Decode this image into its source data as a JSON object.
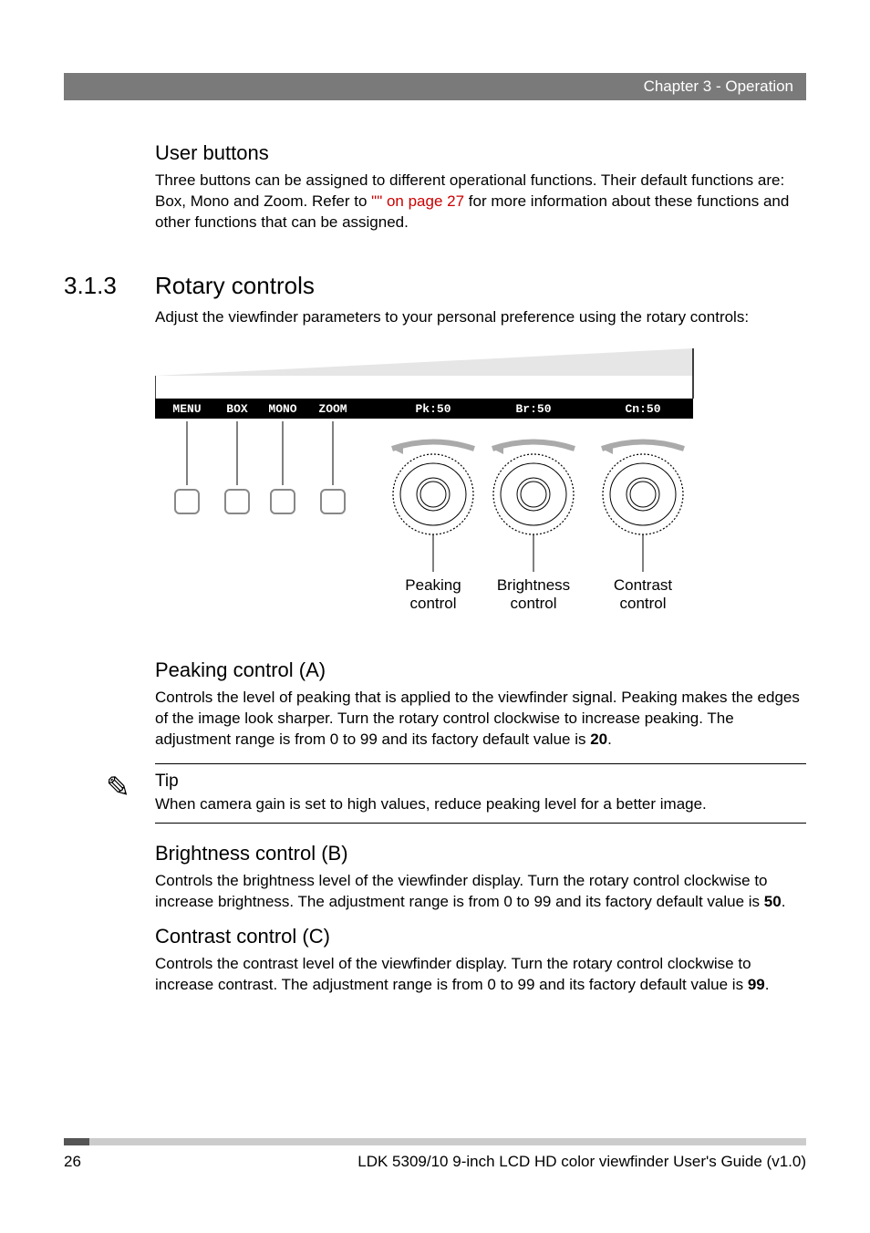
{
  "header": {
    "chapter_label": "Chapter 3 - Operation"
  },
  "user_buttons": {
    "heading": "User buttons",
    "para_before_xref": "Three buttons can be assigned to different operational functions. Their default functions are: Box, Mono and Zoom. Refer to ",
    "xref": "\"\" on page 27",
    "para_after_xref": " for more information about these functions and other functions that can be assigned."
  },
  "rotary": {
    "number": "3.1.3",
    "title": "Rotary controls",
    "intro": "Adjust the viewfinder parameters to your personal preference using the rotary controls:"
  },
  "diagram": {
    "menu_labels": [
      "MENU",
      "BOX",
      "MONO",
      "ZOOM"
    ],
    "value_labels": [
      "Pk:50",
      "Br:50",
      "Cn:50"
    ],
    "control_names": [
      [
        "Peaking",
        "control"
      ],
      [
        "Brightness",
        "control"
      ],
      [
        "Contrast",
        "control"
      ]
    ]
  },
  "peaking": {
    "heading": "Peaking control (A)",
    "para_a": "Controls the level of peaking that is applied to the viewfinder signal. Peaking makes the edges of the image look sharper. Turn the rotary control clockwise to increase peaking. The adjustment range is from 0 to 99 and its factory default value is ",
    "val": "20",
    "para_b": "."
  },
  "tip": {
    "title": "Tip",
    "body": "When camera gain is set to high values, reduce peaking level for a better image."
  },
  "brightness": {
    "heading": "Brightness control (B)",
    "para_a": "Controls the brightness level of the viewfinder display. Turn the rotary control clockwise to increase brightness. The adjustment range is from 0 to 99 and its factory default value is ",
    "val": "50",
    "para_b": "."
  },
  "contrast": {
    "heading": "Contrast control (C)",
    "para_a": "Controls the contrast level of the viewfinder display. Turn the rotary control clockwise to increase contrast. The adjustment range is from 0 to 99 and its factory default value is ",
    "val": "99",
    "para_b": "."
  },
  "footer": {
    "page": "26",
    "doc": "LDK 5309/10 9-inch LCD HD color viewfinder User's Guide (v1.0)"
  }
}
